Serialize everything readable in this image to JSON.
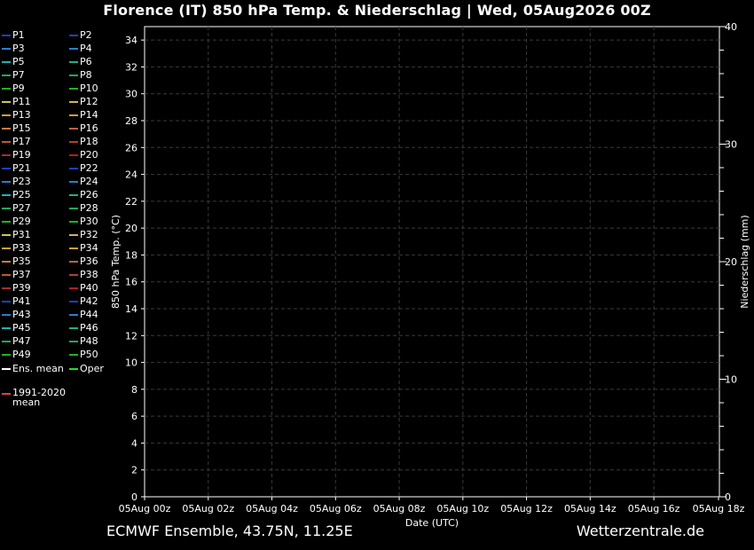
{
  "title": "Florence  (IT)  850 hPa Temp. & Niederschlag | Wed, 05Aug2026 00Z",
  "footer": {
    "source": "ECMWF Ensemble, 43.75N, 11.25E",
    "site": "Wetterzentrale.de"
  },
  "legend": {
    "members": [
      {
        "label": "P1",
        "color": "#1f3fbf"
      },
      {
        "label": "P2",
        "color": "#1f3fbf"
      },
      {
        "label": "P3",
        "color": "#2b7fc8"
      },
      {
        "label": "P4",
        "color": "#2b7fc8"
      },
      {
        "label": "P5",
        "color": "#20b0b0"
      },
      {
        "label": "P6",
        "color": "#20b080"
      },
      {
        "label": "P7",
        "color": "#20a860"
      },
      {
        "label": "P8",
        "color": "#20a860"
      },
      {
        "label": "P9",
        "color": "#22b022"
      },
      {
        "label": "P10",
        "color": "#22b022"
      },
      {
        "label": "P11",
        "color": "#c8c850"
      },
      {
        "label": "P12",
        "color": "#d0b060"
      },
      {
        "label": "P13",
        "color": "#d0a030"
      },
      {
        "label": "P14",
        "color": "#d0a030"
      },
      {
        "label": "P15",
        "color": "#d07840"
      },
      {
        "label": "P16",
        "color": "#c06040"
      },
      {
        "label": "P17",
        "color": "#c05830"
      },
      {
        "label": "P18",
        "color": "#b04030"
      },
      {
        "label": "P19",
        "color": "#a03030"
      },
      {
        "label": "P20",
        "color": "#b02020"
      },
      {
        "label": "P21",
        "color": "#1f3fbf"
      },
      {
        "label": "P22",
        "color": "#1f3fbf"
      },
      {
        "label": "P23",
        "color": "#2b7fc8"
      },
      {
        "label": "P24",
        "color": "#2b7fc8"
      },
      {
        "label": "P25",
        "color": "#20b0b0"
      },
      {
        "label": "P26",
        "color": "#20b080"
      },
      {
        "label": "P27",
        "color": "#20a860"
      },
      {
        "label": "P28",
        "color": "#20a860"
      },
      {
        "label": "P29",
        "color": "#22b022"
      },
      {
        "label": "P30",
        "color": "#22b022"
      },
      {
        "label": "P31",
        "color": "#c8c850"
      },
      {
        "label": "P32",
        "color": "#d0b060"
      },
      {
        "label": "P33",
        "color": "#d0a030"
      },
      {
        "label": "P34",
        "color": "#d0a030"
      },
      {
        "label": "P35",
        "color": "#d07840"
      },
      {
        "label": "P36",
        "color": "#c06040"
      },
      {
        "label": "P37",
        "color": "#c05830"
      },
      {
        "label": "P38",
        "color": "#b04030"
      },
      {
        "label": "P39",
        "color": "#a03030"
      },
      {
        "label": "P40",
        "color": "#b02020"
      },
      {
        "label": "P41",
        "color": "#1f3fbf"
      },
      {
        "label": "P42",
        "color": "#1f3fbf"
      },
      {
        "label": "P43",
        "color": "#2b7fc8"
      },
      {
        "label": "P44",
        "color": "#2b7fc8"
      },
      {
        "label": "P45",
        "color": "#20b0b0"
      },
      {
        "label": "P46",
        "color": "#20b080"
      },
      {
        "label": "P47",
        "color": "#20a860"
      },
      {
        "label": "P48",
        "color": "#20a860"
      },
      {
        "label": "P49",
        "color": "#22b022"
      },
      {
        "label": "P50",
        "color": "#22b022"
      },
      {
        "label": "Ens. mean",
        "color": "#ffffff"
      },
      {
        "label": "Oper",
        "color": "#22dd22"
      }
    ],
    "climatology": {
      "label": "1991-2020\nmean",
      "color": "#e04040"
    }
  },
  "chart_data": {
    "type": "line",
    "title": "Florence  (IT)  850 hPa Temp. & Niederschlag | Wed, 05Aug2026 00Z",
    "xlabel": "Date (UTC)",
    "ylabel": "850 hPa Temp. (°C)",
    "ylabel_right": "Niederschlag (mm)",
    "x_ticks": [
      "05Aug 00z",
      "05Aug 02z",
      "05Aug 04z",
      "05Aug 06z",
      "05Aug 08z",
      "05Aug 10z",
      "05Aug 12z",
      "05Aug 14z",
      "05Aug 16z",
      "05Aug 18z"
    ],
    "ylim": [
      0,
      35
    ],
    "y_ticks": [
      0,
      2,
      4,
      6,
      8,
      10,
      12,
      14,
      16,
      18,
      20,
      22,
      24,
      26,
      28,
      30,
      32,
      34
    ],
    "ylim_right": [
      0,
      40
    ],
    "y_ticks_right": [
      0,
      10,
      20,
      30,
      40
    ],
    "grid": true,
    "series": []
  }
}
